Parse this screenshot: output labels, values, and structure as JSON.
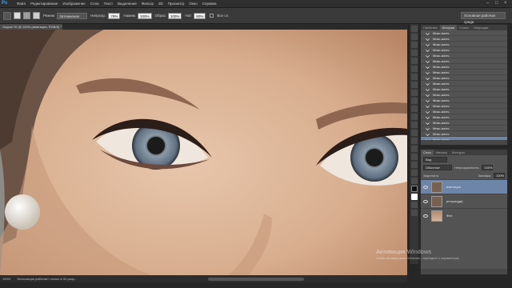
{
  "app": {
    "logo": "Ps"
  },
  "menu": [
    "Файл",
    "Редактирование",
    "Изображение",
    "Слои",
    "Текст",
    "Выделение",
    "Фильтр",
    "3D",
    "Просмотр",
    "Окно",
    "Справка"
  ],
  "options": {
    "mode_label": "Режим:",
    "mode_value": "Затемнение",
    "opacity_label": "Непрозр.:",
    "opacity_value": "79%",
    "flow_label": "Нажим:",
    "flow_value": "100%",
    "smooth_label": "Образ:",
    "smooth_value": "100%",
    "angle_label": "Нат:",
    "angle_value": "60%",
    "all_layers_label": "Все сл."
  },
  "workspace": "Основная рабочая среда",
  "document": {
    "tab_title": "Оцфо2 90 @ 100% (имитация, RGB/8) *"
  },
  "status": {
    "zoom": "100%",
    "info": "Экспозиция работает только в 32-разр..."
  },
  "history": {
    "tabs": [
      "Свойства",
      "История",
      "Стили",
      "Операции"
    ],
    "items": [
      "Микс-кисть",
      "Микс-кисть",
      "Микс-кисть",
      "Микс-кисть",
      "Микс-кисть",
      "Микс-кисть",
      "Микс-кисть",
      "Микс-кисть",
      "Микс-кисть",
      "Микс-кисть",
      "Микс-кисть",
      "Микс-кисть",
      "Микс-кисть",
      "Микс-кисть",
      "Микс-кисть",
      "Микс-кисть",
      "Микс-кисть",
      "Микс-кисть",
      "Микс-кисть",
      "Микс-кисть"
    ],
    "active_index": 19
  },
  "layers": {
    "tabs": [
      "Слои",
      "Каналы",
      "Контуры"
    ],
    "kind_label": "Вид",
    "blend_mode": "Обычные",
    "opacity_label": "Непрозрачность:",
    "opacity_value": "100%",
    "lock_label": "Закрепить:",
    "fill_label": "Заливка:",
    "fill_value": "100%",
    "items": [
      {
        "name": "имитация",
        "active": true
      },
      {
        "name": "ретушь(дв)",
        "active": false
      },
      {
        "name": "Фон",
        "active": false
      }
    ]
  },
  "watermark": {
    "title": "Активация Windows",
    "subtitle": "Чтобы активировать Windows, перейдите к параметрам"
  }
}
